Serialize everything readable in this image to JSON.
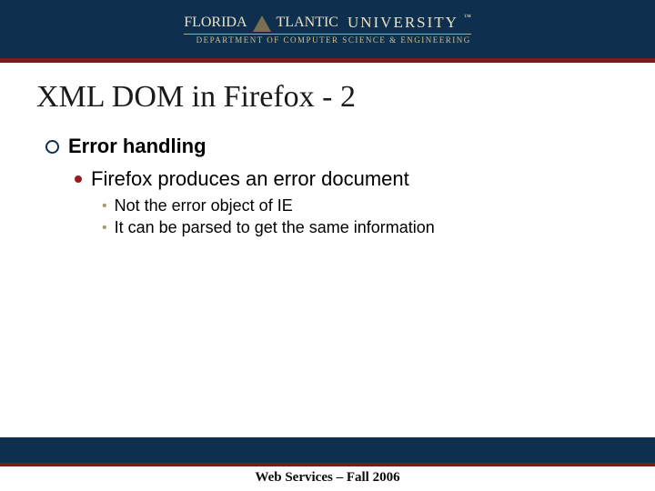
{
  "header": {
    "logo_florida": "FLORIDA",
    "logo_tlantic": "TLANTIC",
    "logo_university": "UNIVERSITY",
    "logo_tm": "™",
    "dept_line": "DEPARTMENT OF COMPUTER SCIENCE & ENGINEERING"
  },
  "title": "XML DOM in Firefox - 2",
  "content": {
    "lvl1": "Error handling",
    "lvl2": "Firefox produces an error document",
    "lvl3a": "Not the error object of IE",
    "lvl3b": "It can be parsed to get the same information"
  },
  "footer": "Web Services – Fall 2006"
}
